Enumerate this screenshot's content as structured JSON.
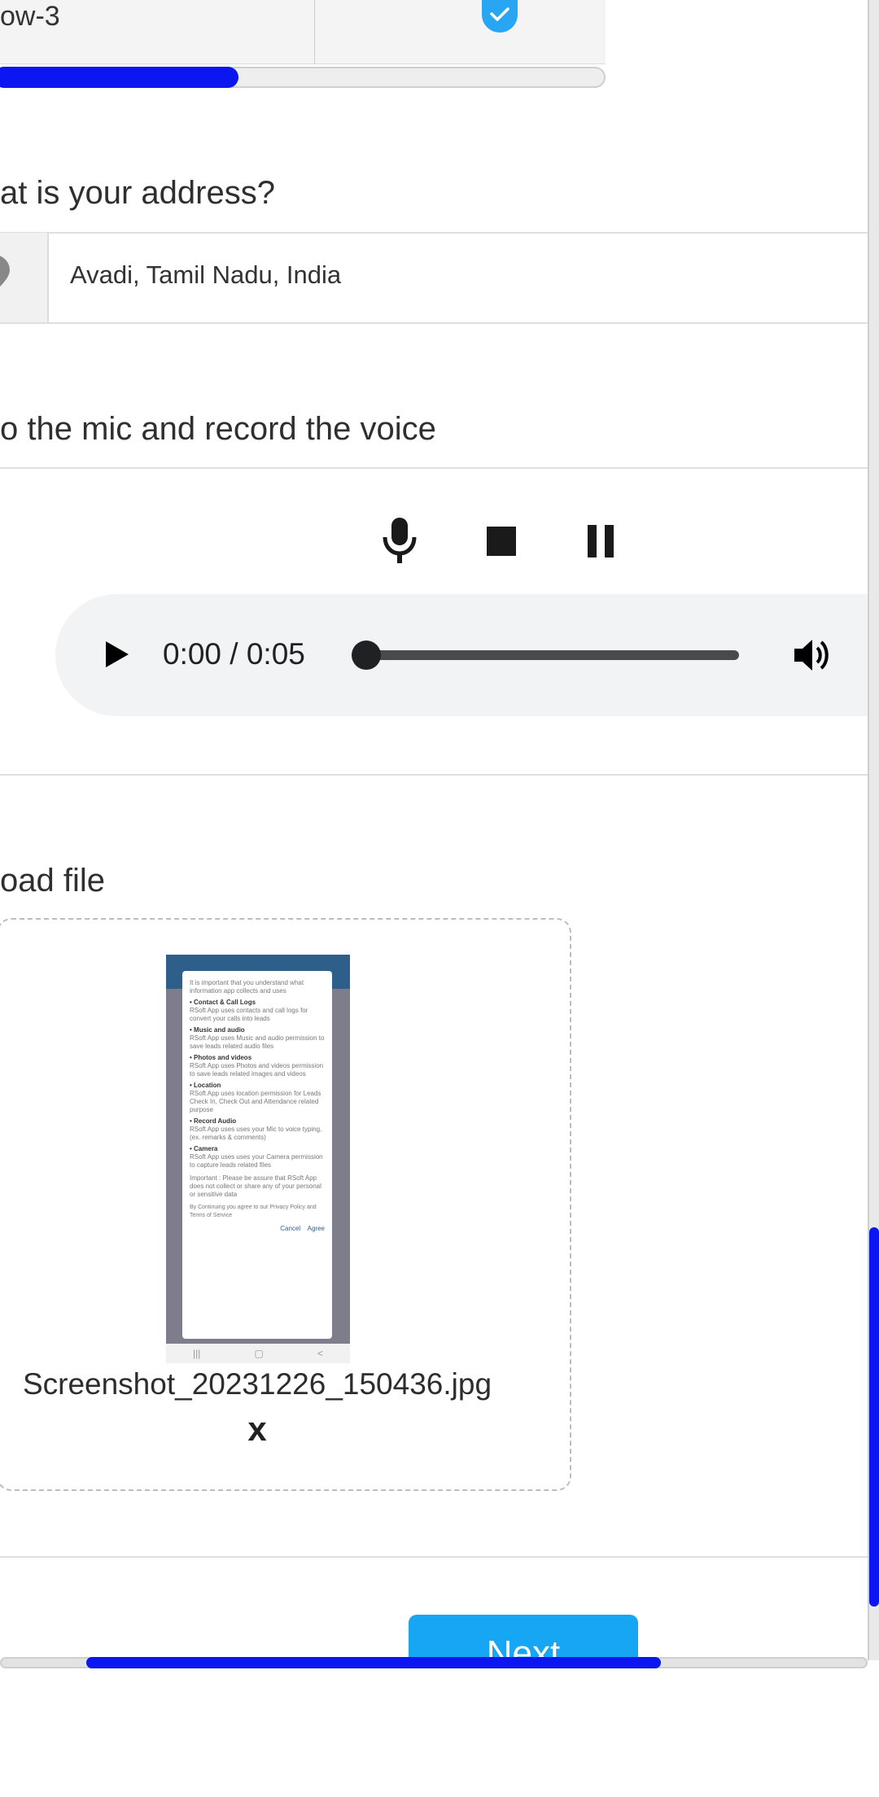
{
  "grid": {
    "row_label": "ow-3",
    "row_checked": true,
    "progress_fraction": 0.4
  },
  "address": {
    "label": "at is your address?",
    "value": "Avadi, Tamil Nadu, India"
  },
  "voice": {
    "label": "o the mic and record the voice",
    "player": {
      "time": "0:00 / 0:05",
      "progress_fraction": 0.0
    }
  },
  "upload": {
    "label": "oad file",
    "file_name": "Screenshot_20231226_150436.jpg",
    "remove_label": "x",
    "thumbnail": {
      "intro": "It is important that you understand what information app collects and uses",
      "sections": [
        {
          "title": "• Contact & Call Logs",
          "text": "RSoft App uses contacts and call logs for convert your calls into leads"
        },
        {
          "title": "• Music and audio",
          "text": "RSoft App uses Music and audio permission to save leads related audio files"
        },
        {
          "title": "• Photos and videos",
          "text": "RSoft App uses Photos and videos permission to save leads related images and videos"
        },
        {
          "title": "• Location",
          "text": "RSoft App uses location permission for Leads Check In, Check Out and Attendance related purpose"
        },
        {
          "title": "• Record Audio",
          "text": "RSoft App uses uses your Mic to voice typing. (ex. remarks & comments)"
        },
        {
          "title": "• Camera",
          "text": "RSoft App uses uses your Camera permission to capture leads related files"
        }
      ],
      "important": "Important : Please be assure that RSoft App does not collect or share any of your personal or sensitive data",
      "consent": "By Continuing you agree to our Privacy Policy and Terms of Service",
      "cancel": "Cancel",
      "agree": "Agree"
    }
  },
  "next_button": "Next",
  "colors": {
    "accent_blue": "#0b16f0",
    "check_blue": "#29a6f3",
    "button_blue": "#17a6f4"
  }
}
